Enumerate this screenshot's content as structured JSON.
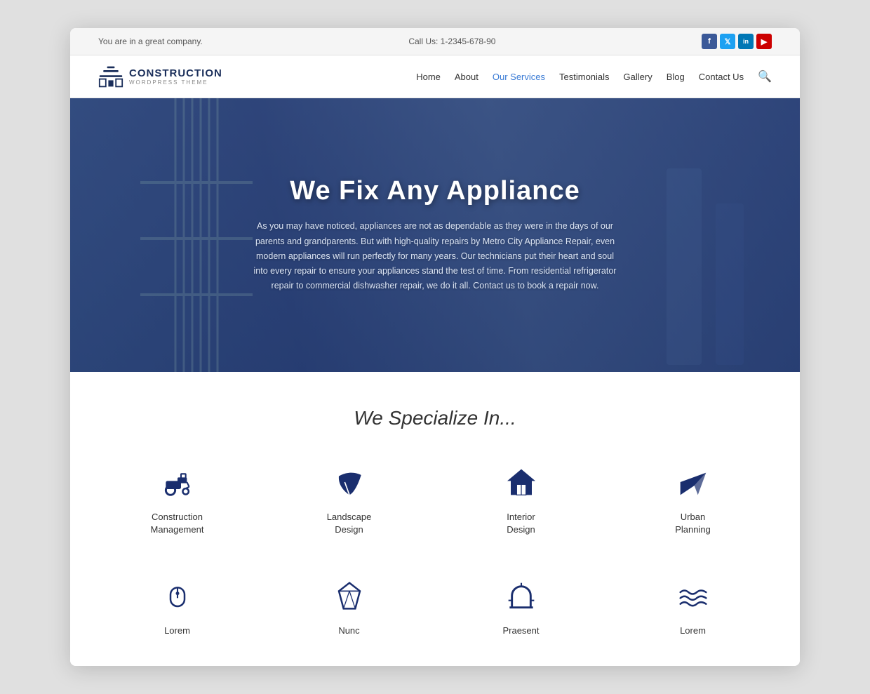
{
  "topbar": {
    "company_text": "You are in a great company.",
    "phone_text": "Call Us: 1-2345-678-90",
    "social": [
      {
        "name": "facebook",
        "label": "f",
        "class": "social-fb"
      },
      {
        "name": "twitter",
        "label": "t",
        "class": "social-tw"
      },
      {
        "name": "linkedin",
        "label": "in",
        "class": "social-li"
      },
      {
        "name": "youtube",
        "label": "▶",
        "class": "social-yt"
      }
    ]
  },
  "nav": {
    "logo_name": "CONSTRUCTION",
    "logo_sub": "WORDPRESS THEME",
    "links": [
      {
        "label": "Home",
        "active": false
      },
      {
        "label": "About",
        "active": false
      },
      {
        "label": "Our Services",
        "active": true
      },
      {
        "label": "Testimonials",
        "active": false
      },
      {
        "label": "Gallery",
        "active": false
      },
      {
        "label": "Blog",
        "active": false
      },
      {
        "label": "Contact Us",
        "active": false
      }
    ]
  },
  "hero": {
    "title": "We Fix Any Appliance",
    "description": "As you may have noticed, appliances are not as dependable as they were in the days of our parents and grandparents. But with high-quality repairs by Metro City Appliance Repair, even modern appliances will run perfectly for many years. Our technicians put their heart and soul into every repair to ensure your appliances stand the test of time. From residential refrigerator repair to commercial dishwasher repair, we do it all. Contact us to book a repair now."
  },
  "specialize": {
    "title": "We Specialize In...",
    "services_row1": [
      {
        "label": "Construction\nManagement",
        "icon": "tractor"
      },
      {
        "label": "Landscape\nDesign",
        "icon": "leaf"
      },
      {
        "label": "Interior\nDesign",
        "icon": "house"
      },
      {
        "label": "Urban\nPlanning",
        "icon": "send"
      }
    ],
    "services_row2": [
      {
        "label": "Lorem",
        "icon": "mouse"
      },
      {
        "label": "Nunc",
        "icon": "gem"
      },
      {
        "label": "Praesent",
        "icon": "arch"
      },
      {
        "label": "Lorem",
        "icon": "waves"
      }
    ]
  }
}
